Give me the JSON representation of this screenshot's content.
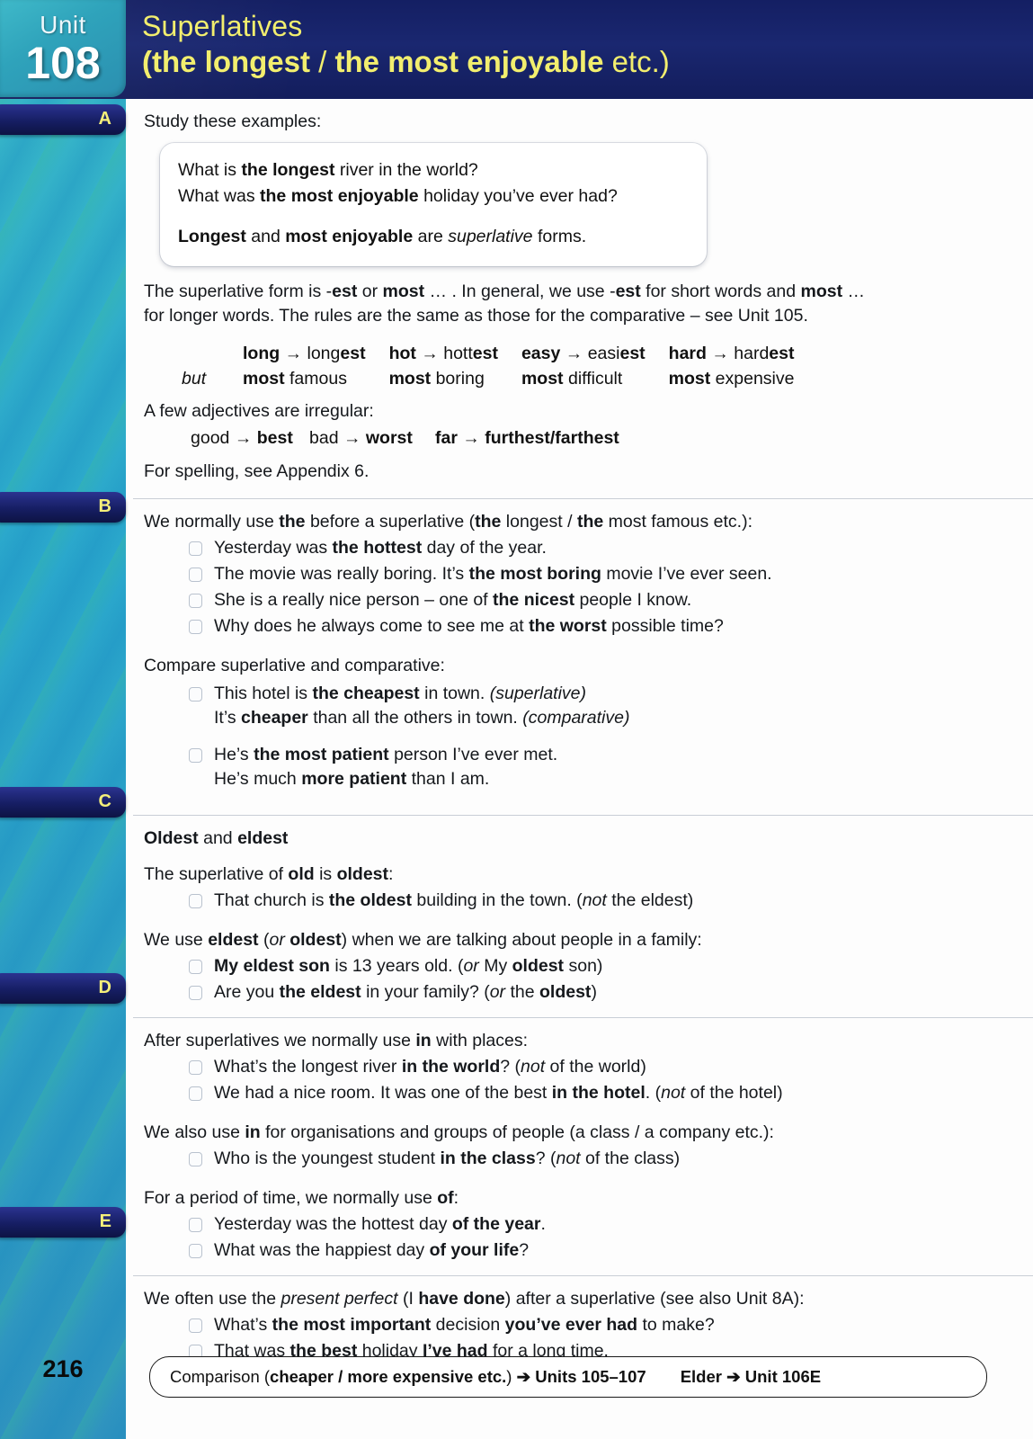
{
  "header": {
    "unit_word": "Unit",
    "unit_number": "108",
    "title_line1": "Superlatives",
    "title_line2_open": "(",
    "title_line2_a": "the longest",
    "title_line2_slash": " / ",
    "title_line2_b": "the most enjoyable",
    "title_line2_etc": " etc.)"
  },
  "sections": {
    "a": {
      "tab": "A",
      "intro": "Study these examples:",
      "example_q1_pre": "What is ",
      "example_q1_bold": "the longest",
      "example_q1_post": " river in the world?",
      "example_q2_pre": "What was ",
      "example_q2_bold": "the most enjoyable",
      "example_q2_post": " holiday you’ve ever had?",
      "example_note_b1": "Longest",
      "example_note_mid": " and ",
      "example_note_b2": "most enjoyable",
      "example_note_tail": " are ",
      "example_note_italic": "superlative",
      "example_note_end": " forms.",
      "rule_p1_1": "The superlative form is -",
      "rule_p1_est": "est",
      "rule_p1_2": " or ",
      "rule_p1_most": "most",
      "rule_p1_3": " … .  In general, we use -",
      "rule_p1_est2": "est",
      "rule_p1_4": " for short words and ",
      "rule_p1_most2": "most",
      "rule_p1_5": " …",
      "rule_p2": "for longer words.  The rules are the same as those for the comparative – see Unit 105.",
      "but_label": "but",
      "forms": [
        {
          "base": "long",
          "arrow": "→",
          "sup_stem": "long",
          "sup_suffix": "est",
          "but_most": "most",
          "but_word": "famous"
        },
        {
          "base": "hot",
          "arrow": "→",
          "sup_stem": "hott",
          "sup_suffix": "est",
          "but_most": "most",
          "but_word": "boring"
        },
        {
          "base": "easy",
          "arrow": "→",
          "sup_stem": "easi",
          "sup_suffix": "est",
          "but_most": "most",
          "but_word": "difficult"
        },
        {
          "base": "hard",
          "arrow": "→",
          "sup_stem": "hard",
          "sup_suffix": "est",
          "but_most": "most",
          "but_word": "expensive"
        }
      ],
      "irregular_intro": "A few adjectives are irregular:",
      "irr_1_base": "good",
      "irr_1_arrow": "→",
      "irr_1_sup": "best",
      "irr_2_base": "bad",
      "irr_2_arrow": "→",
      "irr_2_sup": "worst",
      "irr_3_base": "far",
      "irr_3_arrow": "→",
      "irr_3_sup": "furthest/farthest",
      "spelling": "For spelling, see Appendix 6."
    },
    "b": {
      "tab": "B",
      "lead_1": "We normally use ",
      "lead_the": "the",
      "lead_2": " before a superlative (",
      "lead_the2": "the",
      "lead_3": " longest / ",
      "lead_the3": "the",
      "lead_4": " most famous etc.):",
      "bullets": [
        {
          "pre": "Yesterday was ",
          "bold": "the hottest",
          "post": " day of the year."
        },
        {
          "pre": "The movie was really boring.  It’s ",
          "bold": "the most boring",
          "post": " movie I’ve ever seen."
        },
        {
          "pre": "She is a really nice person – one of ",
          "bold": "the nicest",
          "post": " people I know."
        },
        {
          "pre": "Why does he always come to see me at ",
          "bold": "the worst",
          "post": " possible time?"
        }
      ],
      "compare_lead": "Compare superlative and comparative:",
      "compare": [
        {
          "l1_pre": "This hotel is ",
          "l1_bold": "the cheapest",
          "l1_post": " in town.  ",
          "l1_italic": "(superlative)",
          "l2_pre": "It’s ",
          "l2_bold": "cheaper",
          "l2_post": " than all the others in town.  ",
          "l2_italic": "(comparative)"
        },
        {
          "l1_pre": "He’s ",
          "l1_bold": "the most patient",
          "l1_post": " person I’ve ever met.",
          "l1_italic": "",
          "l2_pre": "He’s much ",
          "l2_bold": "more patient",
          "l2_post": " than I am.",
          "l2_italic": ""
        }
      ]
    },
    "c": {
      "tab": "C",
      "heading_b1": "Oldest",
      "heading_mid": " and ",
      "heading_b2": "eldest",
      "p1_pre": "The superlative of ",
      "p1_b1": "old",
      "p1_mid": " is ",
      "p1_b2": "oldest",
      "p1_post": ":",
      "b1_pre": "That church is ",
      "b1_bold": "the oldest",
      "b1_post": " building in the town.  (",
      "b1_italic": "not",
      "b1_tail": " the eldest)",
      "p2_pre": "We use ",
      "p2_b1": "eldest",
      "p2_mid": " (",
      "p2_i": "or",
      "p2_b2": " oldest",
      "p2_post": ") when we are talking about people in a family:",
      "bullets": [
        {
          "bold_lead": "My eldest son",
          "pre": "",
          "post": " is 13 years old.  (",
          "italic": "or",
          "tail_pre": " My ",
          "tail_bold": "oldest",
          "tail": " son)"
        },
        {
          "bold_lead": "",
          "pre": "Are you ",
          "bold_mid": "the eldest",
          "post": " in your family?  (",
          "italic": "or",
          "tail_pre": " the ",
          "tail_bold": "oldest",
          "tail": ")"
        }
      ]
    },
    "d": {
      "tab": "D",
      "p1_pre": "After superlatives we normally use ",
      "p1_b": "in",
      "p1_post": " with places:",
      "bullets1": [
        {
          "pre": "What’s the longest river ",
          "bold": "in the world",
          "post": "?  (",
          "italic": "not",
          "tail": " of the world)"
        },
        {
          "pre": "We had a nice room.  It was one of the best ",
          "bold": "in the hotel",
          "post": ".  (",
          "italic": "not",
          "tail": " of the hotel)"
        }
      ],
      "p2_pre": "We also use ",
      "p2_b": "in",
      "p2_post": " for organisations and groups of people (a class / a company etc.):",
      "bullets2": [
        {
          "pre": "Who is the youngest student ",
          "bold": "in the class",
          "post": "?  (",
          "italic": "not",
          "tail": " of the class)"
        }
      ],
      "p3_pre": "For a period of time, we normally use ",
      "p3_b": "of",
      "p3_post": ":",
      "bullets3": [
        {
          "pre": "Yesterday was the hottest day ",
          "bold": "of the year",
          "post": "."
        },
        {
          "pre": "What was the happiest day ",
          "bold": "of your life",
          "post": "?"
        }
      ]
    },
    "e": {
      "tab": "E",
      "p1_pre": "We often use the ",
      "p1_italic": "present perfect",
      "p1_mid": " (I ",
      "p1_bold": "have done",
      "p1_post": ") after a superlative (see also Unit 8A):",
      "bullets": [
        {
          "pre": "What’s ",
          "bold": "the most important",
          "mid": " decision ",
          "bold2": "you’ve ever had",
          "post": " to make?"
        },
        {
          "pre": "That was ",
          "bold": "the best",
          "mid": " holiday ",
          "bold2": "I’ve had",
          "post": " for a long time."
        }
      ]
    }
  },
  "footer": {
    "page_number": "216",
    "ref1_pre": "Comparison (",
    "ref1_bold": "cheaper / more expensive etc.",
    "ref1_close": ") ",
    "arrow": "➔",
    "ref1_target": " Units 105–107",
    "ref2_label": "Elder ",
    "ref2_target": " Unit 106E"
  }
}
